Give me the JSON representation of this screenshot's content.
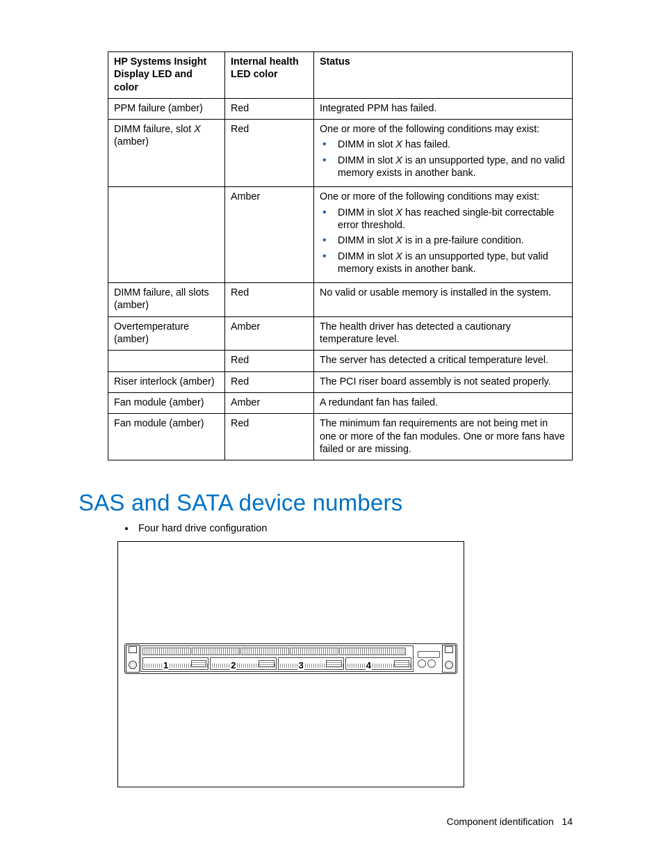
{
  "table": {
    "headers": [
      "HP Systems Insight Display LED and color",
      "Internal health LED color",
      "Status"
    ],
    "rows": [
      {
        "c1": "PPM failure (amber)",
        "c2": "Red",
        "c3_text": "Integrated PPM has failed."
      },
      {
        "c1": "DIMM failure, slot X (amber)",
        "c1_italic_at": "DIMM failure, slot ",
        "c1_italic": "X",
        "c1_after": " (amber)",
        "c2": "Red",
        "c3_lead": "One or more of the following conditions may exist:",
        "c3_list": [
          {
            "pre": "DIMM in slot ",
            "it": "X",
            "post": " has failed."
          },
          {
            "pre": "DIMM in slot ",
            "it": "X",
            "post": " is an unsupported type, and no valid memory exists in another bank."
          }
        ]
      },
      {
        "c1": "",
        "c2": "Amber",
        "c3_lead": "One or more of the following conditions may exist:",
        "c3_list": [
          {
            "pre": "DIMM in slot ",
            "it": "X",
            "post": " has reached single-bit correctable error threshold."
          },
          {
            "pre": "DIMM in slot ",
            "it": "X",
            "post": " is in a pre-failure condition."
          },
          {
            "pre": "DIMM in slot ",
            "it": "X",
            "post": " is an unsupported type, but valid memory exists in another bank."
          }
        ]
      },
      {
        "c1": "DIMM failure, all slots (amber)",
        "c2": "Red",
        "c3_text": "No valid or usable memory is installed in the system."
      },
      {
        "c1": "Overtemperature (amber)",
        "c2": "Amber",
        "c3_text": "The health driver has detected a cautionary temperature level."
      },
      {
        "c1": "",
        "c2": "Red",
        "c3_text": "The server has detected a critical temperature level."
      },
      {
        "c1": "Riser interlock (amber)",
        "c2": "Red",
        "c3_text": "The PCI riser board assembly is not seated properly."
      },
      {
        "c1": "Fan module (amber)",
        "c2": "Amber",
        "c3_text": "A redundant fan has failed."
      },
      {
        "c1": "Fan module (amber)",
        "c2": "Red",
        "c3_text": "The minimum fan requirements are not being met in one or more of the fan modules. One or more fans have failed or are missing."
      }
    ]
  },
  "section_heading": "SAS and SATA device numbers",
  "config_bullet": "Four hard drive configuration",
  "bay_numbers": [
    "1",
    "2",
    "3",
    "4"
  ],
  "footer_section": "Component identification",
  "footer_page": "14"
}
